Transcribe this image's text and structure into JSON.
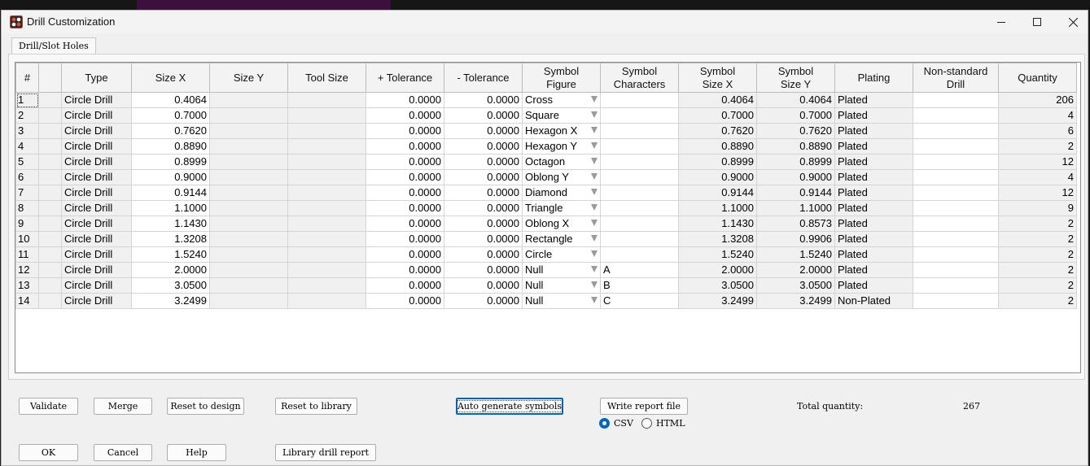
{
  "window": {
    "title": "Drill Customization"
  },
  "tabs": [
    {
      "label": "Drill/Slot Holes"
    }
  ],
  "table": {
    "columns": [
      "#",
      "",
      "Type",
      "Size X",
      "Size Y",
      "Tool Size",
      "+ Tolerance",
      "- Tolerance",
      "Symbol\nFigure",
      "Symbol\nCharacters",
      "Symbol\nSize X",
      "Symbol\nSize Y",
      "Plating",
      "Non-standard\nDrill",
      "Quantity"
    ],
    "rows": [
      {
        "idx": "1",
        "type": "Circle Drill",
        "size_x": "0.4064",
        "size_y": "",
        "tool_size": "",
        "plus_tol": "0.0000",
        "minus_tol": "0.0000",
        "figure": "Cross",
        "chars": "",
        "sym_x": "0.4064",
        "sym_y": "0.4064",
        "plating": "Plated",
        "nonstd": "",
        "qty": "206"
      },
      {
        "idx": "2",
        "type": "Circle Drill",
        "size_x": "0.7000",
        "size_y": "",
        "tool_size": "",
        "plus_tol": "0.0000",
        "minus_tol": "0.0000",
        "figure": "Square",
        "chars": "",
        "sym_x": "0.7000",
        "sym_y": "0.7000",
        "plating": "Plated",
        "nonstd": "",
        "qty": "4"
      },
      {
        "idx": "3",
        "type": "Circle Drill",
        "size_x": "0.7620",
        "size_y": "",
        "tool_size": "",
        "plus_tol": "0.0000",
        "minus_tol": "0.0000",
        "figure": "Hexagon X",
        "chars": "",
        "sym_x": "0.7620",
        "sym_y": "0.7620",
        "plating": "Plated",
        "nonstd": "",
        "qty": "6"
      },
      {
        "idx": "4",
        "type": "Circle Drill",
        "size_x": "0.8890",
        "size_y": "",
        "tool_size": "",
        "plus_tol": "0.0000",
        "minus_tol": "0.0000",
        "figure": "Hexagon Y",
        "chars": "",
        "sym_x": "0.8890",
        "sym_y": "0.8890",
        "plating": "Plated",
        "nonstd": "",
        "qty": "2"
      },
      {
        "idx": "5",
        "type": "Circle Drill",
        "size_x": "0.8999",
        "size_y": "",
        "tool_size": "",
        "plus_tol": "0.0000",
        "minus_tol": "0.0000",
        "figure": "Octagon",
        "chars": "",
        "sym_x": "0.8999",
        "sym_y": "0.8999",
        "plating": "Plated",
        "nonstd": "",
        "qty": "12"
      },
      {
        "idx": "6",
        "type": "Circle Drill",
        "size_x": "0.9000",
        "size_y": "",
        "tool_size": "",
        "plus_tol": "0.0000",
        "minus_tol": "0.0000",
        "figure": "Oblong Y",
        "chars": "",
        "sym_x": "0.9000",
        "sym_y": "0.9000",
        "plating": "Plated",
        "nonstd": "",
        "qty": "4"
      },
      {
        "idx": "7",
        "type": "Circle Drill",
        "size_x": "0.9144",
        "size_y": "",
        "tool_size": "",
        "plus_tol": "0.0000",
        "minus_tol": "0.0000",
        "figure": "Diamond",
        "chars": "",
        "sym_x": "0.9144",
        "sym_y": "0.9144",
        "plating": "Plated",
        "nonstd": "",
        "qty": "12"
      },
      {
        "idx": "8",
        "type": "Circle Drill",
        "size_x": "1.1000",
        "size_y": "",
        "tool_size": "",
        "plus_tol": "0.0000",
        "minus_tol": "0.0000",
        "figure": "Triangle",
        "chars": "",
        "sym_x": "1.1000",
        "sym_y": "1.1000",
        "plating": "Plated",
        "nonstd": "",
        "qty": "9"
      },
      {
        "idx": "9",
        "type": "Circle Drill",
        "size_x": "1.1430",
        "size_y": "",
        "tool_size": "",
        "plus_tol": "0.0000",
        "minus_tol": "0.0000",
        "figure": "Oblong X",
        "chars": "",
        "sym_x": "1.1430",
        "sym_y": "0.8573",
        "plating": "Plated",
        "nonstd": "",
        "qty": "2"
      },
      {
        "idx": "10",
        "type": "Circle Drill",
        "size_x": "1.3208",
        "size_y": "",
        "tool_size": "",
        "plus_tol": "0.0000",
        "minus_tol": "0.0000",
        "figure": "Rectangle",
        "chars": "",
        "sym_x": "1.3208",
        "sym_y": "0.9906",
        "plating": "Plated",
        "nonstd": "",
        "qty": "2"
      },
      {
        "idx": "11",
        "type": "Circle Drill",
        "size_x": "1.5240",
        "size_y": "",
        "tool_size": "",
        "plus_tol": "0.0000",
        "minus_tol": "0.0000",
        "figure": "Circle",
        "chars": "",
        "sym_x": "1.5240",
        "sym_y": "1.5240",
        "plating": "Plated",
        "nonstd": "",
        "qty": "2"
      },
      {
        "idx": "12",
        "type": "Circle Drill",
        "size_x": "2.0000",
        "size_y": "",
        "tool_size": "",
        "plus_tol": "0.0000",
        "minus_tol": "0.0000",
        "figure": "Null",
        "chars": "A",
        "sym_x": "2.0000",
        "sym_y": "2.0000",
        "plating": "Plated",
        "nonstd": "",
        "qty": "2"
      },
      {
        "idx": "13",
        "type": "Circle Drill",
        "size_x": "3.0500",
        "size_y": "",
        "tool_size": "",
        "plus_tol": "0.0000",
        "minus_tol": "0.0000",
        "figure": "Null",
        "chars": "B",
        "sym_x": "3.0500",
        "sym_y": "3.0500",
        "plating": "Plated",
        "nonstd": "",
        "qty": "2"
      },
      {
        "idx": "14",
        "type": "Circle Drill",
        "size_x": "3.2499",
        "size_y": "",
        "tool_size": "",
        "plus_tol": "0.0000",
        "minus_tol": "0.0000",
        "figure": "Null",
        "chars": "C",
        "sym_x": "3.2499",
        "sym_y": "3.2499",
        "plating": "Non-Plated",
        "nonstd": "",
        "qty": "2"
      }
    ]
  },
  "buttons": {
    "validate": "Validate",
    "merge": "Merge",
    "reset_design": "Reset to design",
    "reset_library": "Reset to library",
    "auto_generate": "Auto generate symbols",
    "write_report": "Write report file",
    "ok": "OK",
    "cancel": "Cancel",
    "help": "Help",
    "library_report": "Library drill report"
  },
  "report_format": {
    "options": [
      "CSV",
      "HTML"
    ],
    "selected": "CSV"
  },
  "total": {
    "label": "Total quantity:",
    "value": "267"
  },
  "colors": {
    "accent": "#0067c0",
    "window_bg": "#f0f0f0",
    "grid_bg": "#ffffff"
  },
  "icons": {
    "app": "drill-app-icon",
    "minimize": "minimize-icon",
    "maximize": "maximize-icon",
    "close": "close-icon",
    "dropdown": "dropdown-arrow-icon"
  }
}
